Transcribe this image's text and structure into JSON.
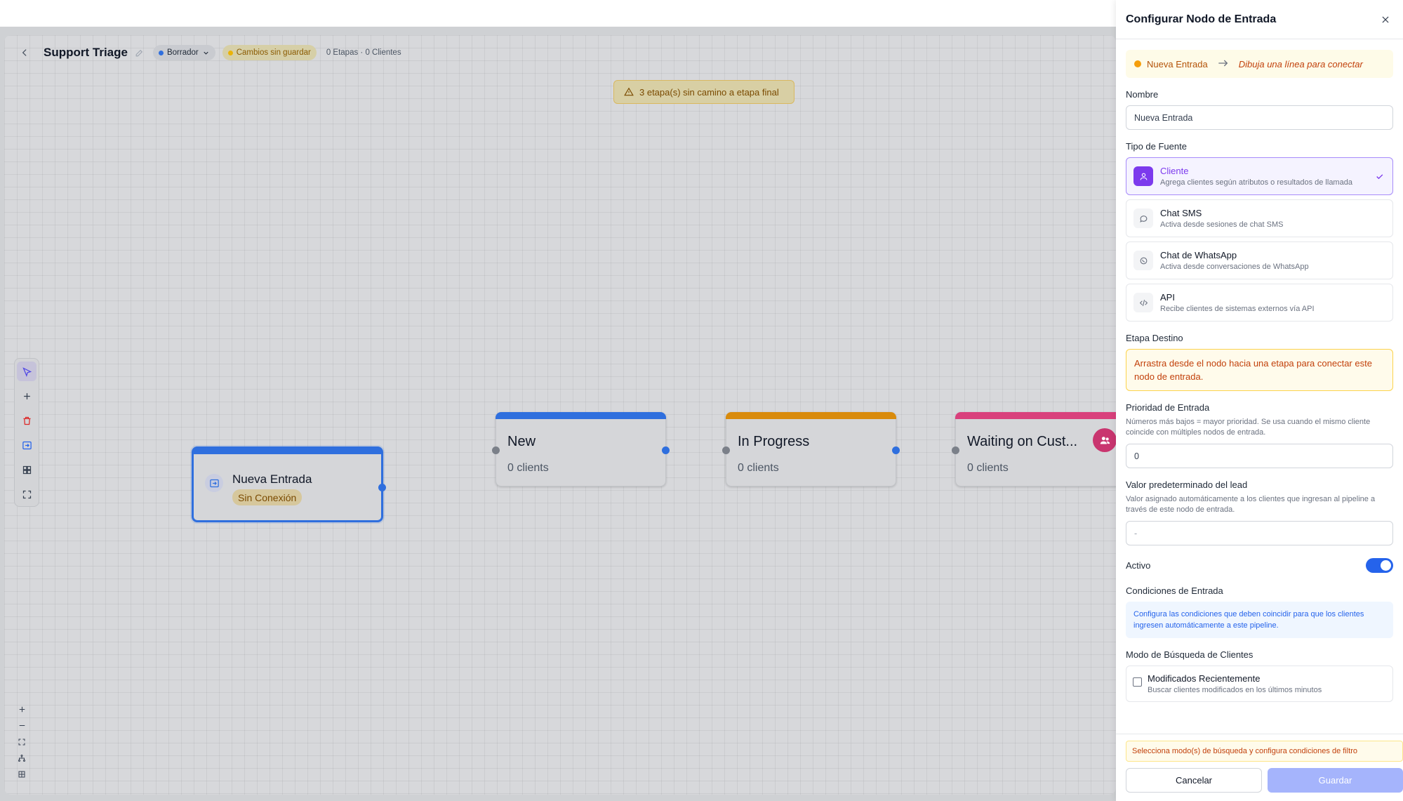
{
  "header": {
    "pipeline_title": "Support Triage",
    "status_label": "Borrador",
    "unsaved_label": "Cambios sin guardar",
    "counts": "0 Etapas · 0 Clientes"
  },
  "canvas": {
    "warning": "3 etapa(s) sin camino a etapa final",
    "entry_node": {
      "name": "Nueva Entrada",
      "badge": "Sin Conexión"
    },
    "stages": [
      {
        "name": "New",
        "clients": "0 clients",
        "color": "#2f6fde"
      },
      {
        "name": "In Progress",
        "clients": "0 clients",
        "color": "#d98b0c"
      },
      {
        "name": "Waiting on Cust...",
        "clients": "0 clients",
        "color": "#d9407c"
      }
    ]
  },
  "colors": {
    "accent": "#2563eb",
    "draft_dot": "#2f6fde",
    "unsaved_dot": "#eab308",
    "selected_source": "#7c3aed"
  },
  "panel": {
    "title": "Configurar Nodo de Entrada",
    "connection": {
      "node_label": "Nueva Entrada",
      "hint": "Dibuja una línea para conectar"
    },
    "name_label": "Nombre",
    "name_value": "Nueva Entrada",
    "source_label": "Tipo de Fuente",
    "sources": [
      {
        "title": "Cliente",
        "desc": "Agrega clientes según atributos o resultados de llamada",
        "icon": "user-icon"
      },
      {
        "title": "Chat SMS",
        "desc": "Activa desde sesiones de chat SMS",
        "icon": "chat-bubble-icon"
      },
      {
        "title": "Chat de WhatsApp",
        "desc": "Activa desde conversaciones de WhatsApp",
        "icon": "whatsapp-icon"
      },
      {
        "title": "API",
        "desc": "Recibe clientes de sistemas externos vía API",
        "icon": "code-icon"
      }
    ],
    "dest_label": "Etapa Destino",
    "dest_warning": "Arrastra desde el nodo hacia una etapa para conectar este nodo de entrada.",
    "priority_label": "Prioridad de Entrada",
    "priority_help": "Números más bajos = mayor prioridad. Se usa cuando el mismo cliente coincide con múltiples nodos de entrada.",
    "priority_value": "0",
    "lead_value_label": "Valor predeterminado del lead",
    "lead_value_help": "Valor asignado automáticamente a los clientes que ingresan al pipeline a través de este nodo de entrada.",
    "lead_value_placeholder": "-",
    "active_label": "Activo",
    "conditions_label": "Condiciones de Entrada",
    "conditions_info": "Configura las condiciones que deben coincidir para que los clientes ingresen automáticamente a este pipeline.",
    "search_mode_label": "Modo de Búsqueda de Clientes",
    "search_mode": {
      "title": "Modificados Recientemente",
      "desc": "Buscar clientes modificados en los últimos minutos"
    },
    "footer_warning": "Selecciona modo(s) de búsqueda y configura condiciones de filtro",
    "cancel_label": "Cancelar",
    "save_label": "Guardar"
  }
}
